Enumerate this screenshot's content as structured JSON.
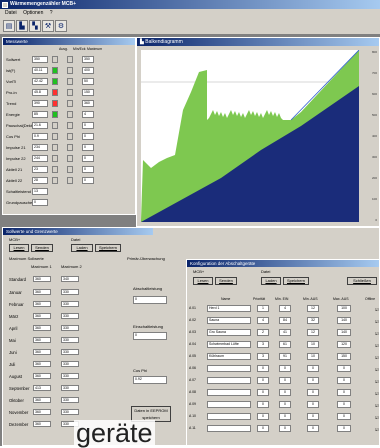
{
  "window": {
    "title": "Wärmemengenzähler MCB+"
  },
  "menu": [
    "Datei",
    "Optionen",
    "?"
  ],
  "messwerte": {
    "title": "Messwerte",
    "headers": [
      "Ausg.",
      "Min/Eck",
      "Maximum"
    ],
    "rows": [
      {
        "label": "Sollwert",
        "value": "350",
        "b1": "#d4d0c8",
        "b2": "#d4d0c8",
        "max": "350"
      },
      {
        "label": "Ist(F)",
        "value": "40.11",
        "b1": "#20c020",
        "b2": "#d4d0c8",
        "max": "400"
      },
      {
        "label": "VorlTi",
        "value": "42.42",
        "b1": "#20c020",
        "b2": "#d4d0c8",
        "max": "50"
      },
      {
        "label": "Pro-in",
        "value": "45.8",
        "b1": "#ff3030",
        "b2": "#d4d0c8",
        "max": "150"
      },
      {
        "label": "Trend",
        "value": "390",
        "b1": "#ff3030",
        "b2": "#d4d0c8",
        "max": "360"
      },
      {
        "label": "Energie",
        "value": "85",
        "b1": "#20c020",
        "b2": "#d4d0c8",
        "max": "4"
      },
      {
        "label": "Pauschal(Dekt.)",
        "value": "21.6",
        "b1": "#d4d0c8",
        "b2": "#d4d0c8",
        "max": "0"
      },
      {
        "label": "Cos Phi",
        "value": "0.9",
        "b1": "#d4d0c8",
        "b2": "#d4d0c8",
        "max": "0"
      },
      {
        "label": "Impulse 21",
        "value": "234",
        "b1": "#d4d0c8",
        "b2": "#d4d0c8",
        "max": "0"
      },
      {
        "label": "Impulse 22",
        "value": "244",
        "b1": "#d4d0c8",
        "b2": "#d4d0c8",
        "max": "0"
      },
      {
        "label": "Aktiell 21",
        "value": "23",
        "b1": "#d4d0c8",
        "b2": "#d4d0c8",
        "max": "0"
      },
      {
        "label": "Aktiell 22",
        "value": "28",
        "b1": "#d4d0c8",
        "b2": "#d4d0c8",
        "max": "0"
      },
      {
        "label": "Schaltleistend",
        "value": "13",
        "b1": "",
        "b2": "",
        "max": ""
      },
      {
        "label": "Grundpauschel",
        "value": "0",
        "b1": "",
        "b2": "",
        "max": ""
      }
    ]
  },
  "chart": {
    "title": "Balkendiagramm",
    "y_ticks": [
      "800",
      "700",
      "600",
      "500",
      "400",
      "300",
      "200",
      "100",
      "0"
    ]
  },
  "chart_data": {
    "type": "area",
    "series": [
      {
        "color": "#7ec850"
      },
      {
        "color": "#1a2c7a"
      }
    ],
    "ylim": [
      0,
      800
    ]
  },
  "lower": {
    "title": "Sollwerte und Grenzwerte",
    "mcb_label": "MCB+",
    "datei_label": "Datei",
    "btn_lesen": "Lesen",
    "btn_senden": "Senden",
    "btn_laden": "Laden",
    "btn_speichern": "Speichern",
    "max_group": "Maximum Sollwerte",
    "prim_group": "Primär-Überwachung",
    "col1": "Maximum 1",
    "col2": "Maximum 2",
    "standard_label": "Standard",
    "standard_values": [
      "360",
      "340"
    ],
    "months": [
      {
        "name": "Januar",
        "v1": "360",
        "v2": "330"
      },
      {
        "name": "Februar",
        "v1": "360",
        "v2": "330"
      },
      {
        "name": "März",
        "v1": "360",
        "v2": "330"
      },
      {
        "name": "April",
        "v1": "360",
        "v2": "330"
      },
      {
        "name": "Mai",
        "v1": "360",
        "v2": "330"
      },
      {
        "name": "Juni",
        "v1": "360",
        "v2": "330"
      },
      {
        "name": "Juli",
        "v1": "360",
        "v2": "330"
      },
      {
        "name": "August",
        "v1": "360",
        "v2": "330"
      },
      {
        "name": "September",
        "v1": "413",
        "v2": "330"
      },
      {
        "name": "Oktober",
        "v1": "360",
        "v2": "330"
      },
      {
        "name": "November",
        "v1": "360",
        "v2": "330"
      },
      {
        "name": "Dezember",
        "v1": "360",
        "v2": "330"
      }
    ],
    "abschalt_label": "Abschaltleistung",
    "abschalt_value": "0",
    "einschalt_label": "Einschaltleistung",
    "einschalt_value": "0",
    "cosphi_label": "Cos Phi",
    "cosphi_value": "0.92",
    "eeprom_button": "Daten in EEPROM speichern"
  },
  "sub": {
    "title": "Konfiguration der Abschaltgeräte",
    "mcb_label": "MCB+",
    "datei_label": "Datei",
    "btn_lesen": "Lesen",
    "btn_senden": "Senden",
    "btn_laden": "Laden",
    "btn_speichern": "Speichern",
    "btn_schliessen": "Schließen",
    "headers": [
      "Name",
      "Priorität",
      "Min. EIN",
      "Min. AUS",
      "Max. AUS",
      "Offline"
    ],
    "rows": [
      {
        "id": "A 01",
        "name": "Herd 1",
        "p": "1",
        "a": "4",
        "b": "12",
        "c": "100"
      },
      {
        "id": "A 02",
        "name": "Sauna",
        "p": "4",
        "a": "84",
        "b": "32",
        "c": "140"
      },
      {
        "id": "A 03",
        "name": "Gro Sauna",
        "p": "2",
        "a": "41",
        "b": "12",
        "c": "140"
      },
      {
        "id": "A 04",
        "name": "Schwimmbad Lüfte",
        "p": "3",
        "a": "61",
        "b": "10",
        "c": "120"
      },
      {
        "id": "A 05",
        "name": "Kühlraum",
        "p": "3",
        "a": "91",
        "b": "10",
        "c": "150"
      },
      {
        "id": "A 06",
        "name": "",
        "p": "0",
        "a": "0",
        "b": "0",
        "c": "0"
      },
      {
        "id": "A 07",
        "name": "",
        "p": "0",
        "a": "0",
        "b": "0",
        "c": "0"
      },
      {
        "id": "A 08",
        "name": "",
        "p": "0",
        "a": "0",
        "b": "0",
        "c": "0"
      },
      {
        "id": "A 09",
        "name": "",
        "p": "0",
        "a": "0",
        "b": "0",
        "c": "0"
      },
      {
        "id": "A 10",
        "name": "",
        "p": "0",
        "a": "0",
        "b": "0",
        "c": "0"
      },
      {
        "id": "A 11",
        "name": "",
        "p": "0",
        "a": "0",
        "b": "0",
        "c": "0"
      }
    ]
  },
  "overlay": {
    "text": "geräte"
  }
}
